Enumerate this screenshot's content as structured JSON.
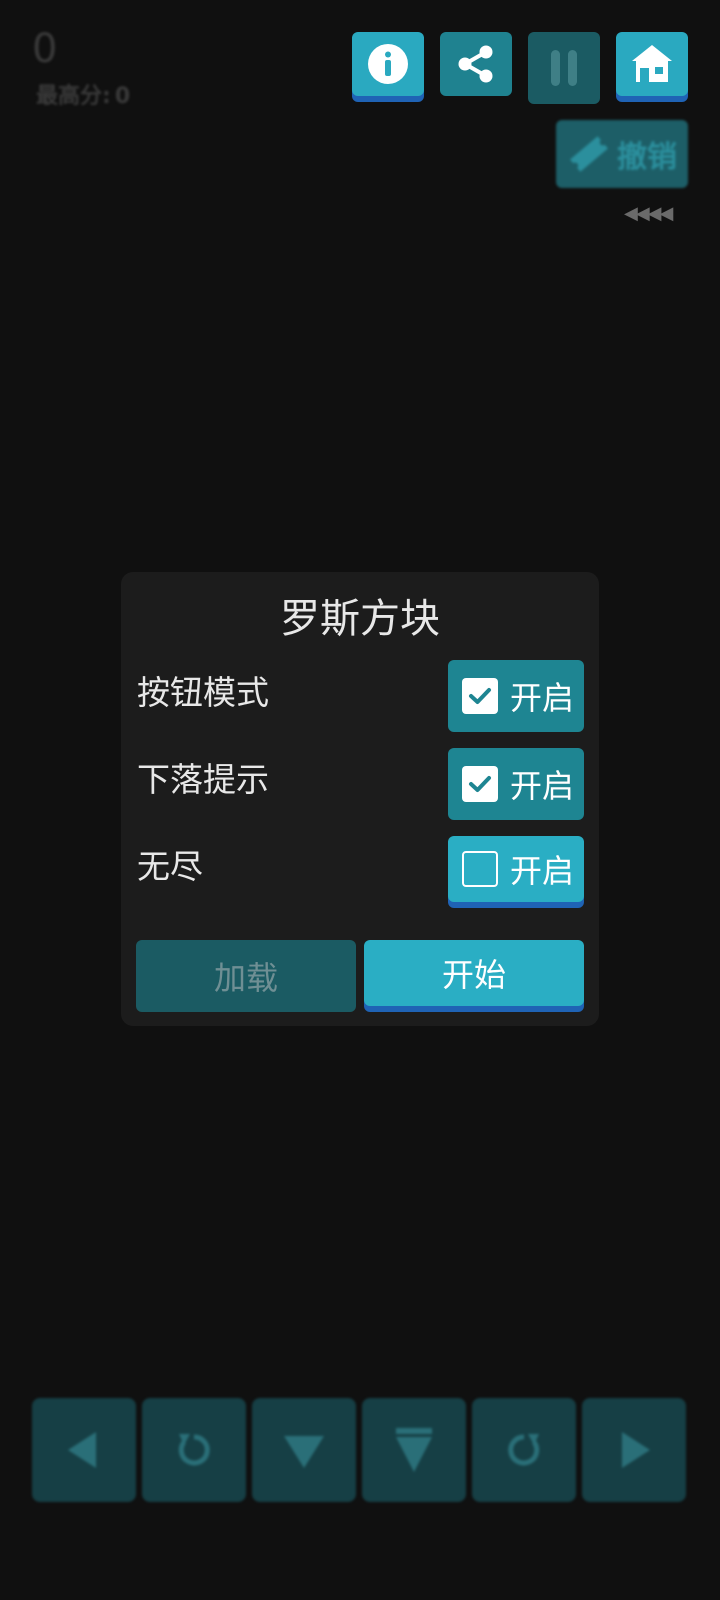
{
  "score": {
    "current": "0",
    "best_label": "最高分:",
    "best_value": "0"
  },
  "toolbar": {
    "info_icon": "info-icon",
    "share_icon": "share-icon",
    "pause_icon": "pause-icon",
    "home_icon": "home-icon"
  },
  "undo": {
    "label": "撤销",
    "arrows": "◀◀◀◀"
  },
  "dialog": {
    "title": "罗斯方块",
    "options": [
      {
        "label": "按钮模式",
        "toggle_label": "开启",
        "checked": true
      },
      {
        "label": "下落提示",
        "toggle_label": "开启",
        "checked": true
      },
      {
        "label": "无尽",
        "toggle_label": "开启",
        "checked": false
      }
    ],
    "load_label": "加载",
    "start_label": "开始"
  },
  "controls": [
    "left-arrow-icon",
    "rotate-left-icon",
    "down-arrow-icon",
    "hard-drop-icon",
    "rotate-right-icon",
    "right-arrow-icon"
  ],
  "colors": {
    "accent": "#2aaec4",
    "accent_dark": "#1e8592",
    "shadow": "#1f63b5",
    "bg": "#101010",
    "dialog_bg": "#1c1c1c"
  }
}
